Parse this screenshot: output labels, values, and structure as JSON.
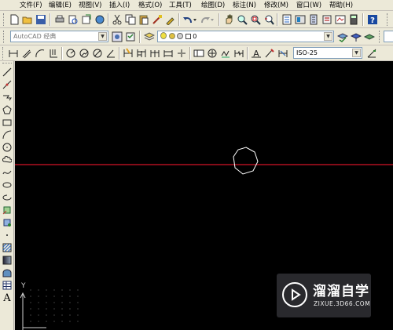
{
  "menu": [
    "文件(F)",
    "编辑(E)",
    "视图(V)",
    "插入(I)",
    "格式(O)",
    "工具(T)",
    "绘图(D)",
    "标注(N)",
    "修改(M)",
    "窗口(W)",
    "帮助(H)"
  ],
  "workspace_combo": "AutoCAD 经典",
  "layer_combo": "0",
  "dim_style_combo": "ISO-25",
  "ucs_label": "Y",
  "watermark": {
    "title": "溜溜自学",
    "url": "ZIXUE.3D66.COM"
  },
  "colors": {
    "canvas": "#000000",
    "crosshair": "#b01020",
    "polygon": "#ffffff",
    "toolbar": "#ece9d8"
  },
  "icons": {
    "standard_toolbar": [
      "new-icon",
      "open-icon",
      "save-icon",
      "print-icon",
      "print-preview-icon",
      "publish-icon",
      "cut-icon",
      "copy-icon",
      "paste-icon",
      "match-properties-icon",
      "block-editor-icon",
      "undo-icon",
      "redo-icon",
      "pan-icon",
      "zoom-realtime-icon",
      "zoom-window-icon",
      "zoom-previous-icon",
      "properties-icon",
      "design-center-icon",
      "tool-palettes-icon",
      "sheet-set-icon",
      "markup-icon",
      "calculator-icon",
      "help-icon"
    ],
    "draw_toolbar": [
      "line-icon",
      "construction-line-icon",
      "polyline-icon",
      "polygon-icon",
      "rectangle-icon",
      "arc-icon",
      "circle-icon",
      "revision-cloud-icon",
      "spline-icon",
      "ellipse-icon",
      "ellipse-arc-icon",
      "insert-block-icon",
      "make-block-icon",
      "point-icon",
      "hatch-icon",
      "gradient-icon",
      "region-icon",
      "table-icon",
      "multiline-text-icon"
    ]
  }
}
